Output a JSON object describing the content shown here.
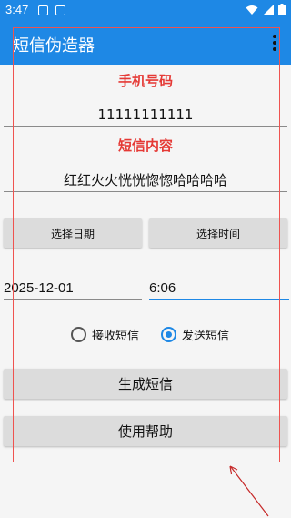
{
  "status_bar": {
    "time": "3:47",
    "icons": [
      "image-icon",
      "font-a-icon",
      "wifi-icon",
      "signal-icon",
      "battery-icon"
    ]
  },
  "app_bar": {
    "title": "短信伪造器",
    "overflow_icon": "more-vert-icon"
  },
  "phone": {
    "label": "手机号码",
    "value": "11111111111"
  },
  "sms": {
    "label": "短信内容",
    "value": "红红火火恍恍惚惚哈哈哈哈"
  },
  "buttons": {
    "select_date": "选择日期",
    "select_time": "选择时间",
    "generate": "生成短信",
    "help": "使用帮助"
  },
  "datetime": {
    "date": "2025-12-01",
    "time": "6:06"
  },
  "sms_type": {
    "options": [
      "接收短信",
      "发送短信"
    ],
    "selected": "发送短信"
  },
  "colors": {
    "primary": "#1e88e5",
    "label_red": "#e53935",
    "annotation_red": "#ef5350",
    "button_gray": "#dcdcdc"
  }
}
